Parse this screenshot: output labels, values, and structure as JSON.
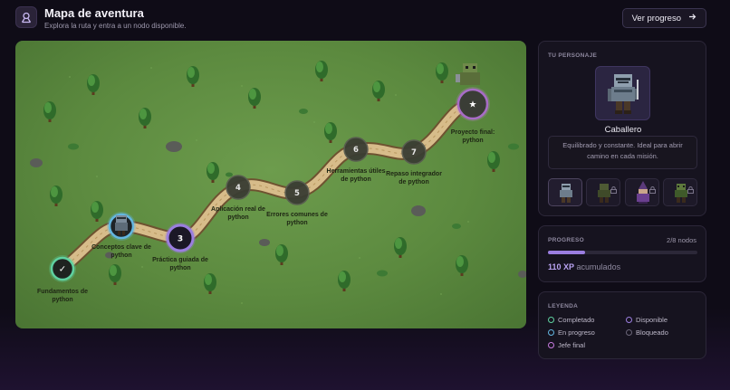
{
  "header": {
    "title": "Mapa de aventura",
    "subtitle": "Explora la ruta y entra a un nodo disponible.",
    "progress_button": "Ver progreso",
    "logo_icon": "map-pin-icon"
  },
  "map": {
    "nodes": [
      {
        "id": 1,
        "marker": "✓",
        "state": "completed",
        "label_line1": "Fundamentos de",
        "label_line2": "python"
      },
      {
        "id": 2,
        "marker": "",
        "state": "in-progress",
        "label_line1": "Conceptos clave de",
        "label_line2": "python"
      },
      {
        "id": 3,
        "marker": "3",
        "state": "available",
        "label_line1": "Práctica guiada de",
        "label_line2": "python"
      },
      {
        "id": 4,
        "marker": "4",
        "state": "locked",
        "label_line1": "Aplicación real de",
        "label_line2": "python"
      },
      {
        "id": 5,
        "marker": "5",
        "state": "locked",
        "label_line1": "Errores comunes de",
        "label_line2": "python"
      },
      {
        "id": 6,
        "marker": "6",
        "state": "locked",
        "label_line1": "Herramientas útiles",
        "label_line2": "de python"
      },
      {
        "id": 7,
        "marker": "7",
        "state": "locked",
        "label_line1": "Repaso integrador",
        "label_line2": "de python"
      },
      {
        "id": 8,
        "marker": "★",
        "state": "boss",
        "label_line1": "Proyecto final:",
        "label_line2": "python"
      }
    ]
  },
  "character": {
    "heading": "TU PERSONAJE",
    "name": "Caballero",
    "description": "Equilibrado y constante. Ideal para abrir camino en cada misión.",
    "slots": [
      {
        "icon": "knight-icon",
        "locked": false
      },
      {
        "icon": "ranger-icon",
        "locked": true
      },
      {
        "icon": "mage-icon",
        "locked": true
      },
      {
        "icon": "goblin-icon",
        "locked": true
      }
    ]
  },
  "progress": {
    "heading": "PROGRESO",
    "count": "2/8 nodos",
    "fraction": 0.25,
    "xp_value": "110 XP",
    "xp_suffix": "acumulados"
  },
  "legend": {
    "heading": "LEYENDA",
    "items": [
      {
        "label": "Completado",
        "color": "#5fd1a0"
      },
      {
        "label": "Disponible",
        "color": "#9b7ee0"
      },
      {
        "label": "En progreso",
        "color": "#63b6e0"
      },
      {
        "label": "Bloqueado",
        "color": "#6a6578"
      },
      {
        "label": "Jefe final",
        "color": "#c77be0"
      }
    ]
  },
  "colors": {
    "accent": "#9b7ee0",
    "completed": "#5fd1a0",
    "in_progress": "#63b6e0",
    "locked": "#3a3d33",
    "boss": "#c77be0"
  }
}
